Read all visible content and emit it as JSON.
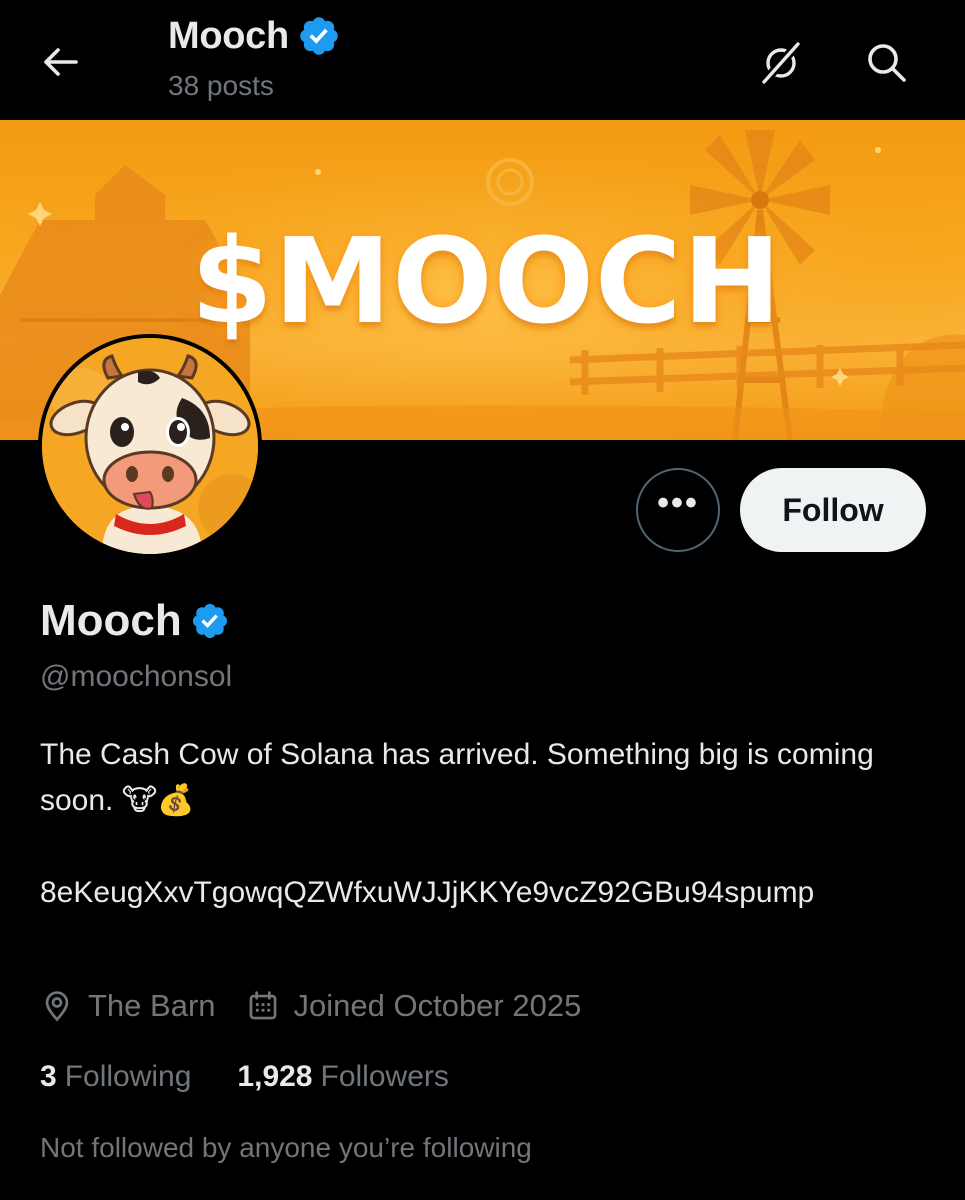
{
  "header": {
    "title": "Mooch",
    "posts_count": "38 posts",
    "back_icon": "arrow-left-icon",
    "grok_icon": "grok-icon",
    "search_icon": "search-icon"
  },
  "banner": {
    "text": "$MOOCH"
  },
  "actions": {
    "more_label": "•••",
    "follow_label": "Follow"
  },
  "profile": {
    "display_name": "Mooch",
    "handle": "@moochonsol",
    "bio": "The Cash Cow of Solana has arrived. Something big is coming soon. 🐮💰",
    "address": "8eKeugXxvTgowqQZWfxuWJJjKKYe9vcZ92GBu94spump",
    "location": "The Barn",
    "joined": "Joined October 2025",
    "following_count": "3",
    "following_label": "Following",
    "followers_count": "1,928",
    "followers_label": "Followers",
    "not_followed_text": "Not followed by anyone you’re following"
  },
  "colors": {
    "background": "#000000",
    "text_primary": "#e7e9ea",
    "text_secondary": "#71767b",
    "verified_blue": "#1d9bf0",
    "banner_orange": "#f7a91f",
    "follow_button_bg": "#eff3f4"
  }
}
